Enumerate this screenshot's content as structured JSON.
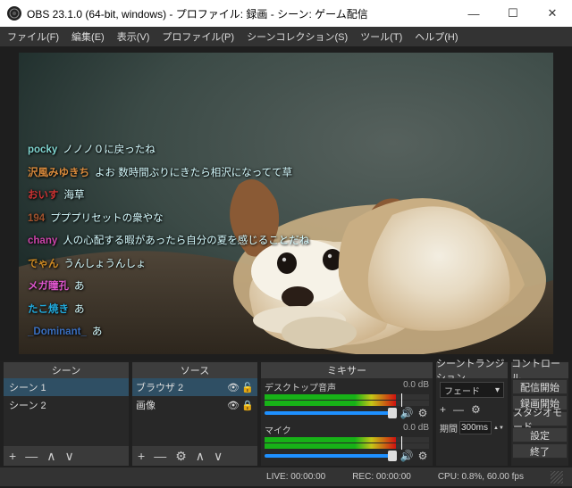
{
  "title": "OBS 23.1.0 (64-bit, windows) - プロファイル: 録画 - シーン: ゲーム配信",
  "menu": {
    "file": "ファイル(F)",
    "edit": "編集(E)",
    "view": "表示(V)",
    "profile": "プロファイル(P)",
    "scenecol": "シーンコレクション(S)",
    "tools": "ツール(T)",
    "help": "ヘルプ(H)"
  },
  "chat": [
    {
      "user": "pocky",
      "color": "#7fd4cf",
      "msg": "ノノノ０に戻ったね"
    },
    {
      "user": "沢風みゆきち",
      "color": "#d88a3c",
      "msg": "よお 数時間ぶりにきたら相沢になってて草"
    },
    {
      "user": "おいす",
      "color": "#cc3333",
      "msg": "海草"
    },
    {
      "user": "194",
      "color": "#a0522d",
      "msg": "プププリセットの衆やな"
    },
    {
      "user": "chany",
      "color": "#cc44aa",
      "msg": "人の心配する暇があったら自分の夏を感じることだね"
    },
    {
      "user": "でゃん",
      "color": "#cc8822",
      "msg": "うんしょうんしょ"
    },
    {
      "user": "メガ瞳孔",
      "color": "#dd55cc",
      "msg": "あ"
    },
    {
      "user": "たこ焼き",
      "color": "#22aadd",
      "msg": "あ"
    },
    {
      "user": "_Dominant_",
      "color": "#3a6fc0",
      "msg": "あ"
    }
  ],
  "panels": {
    "scenes_h": "シーン",
    "sources_h": "ソース",
    "mixer_h": "ミキサー",
    "trans_h": "シーントランジション",
    "ctrl_h": "コントロール",
    "scene_items": [
      "シーン 1",
      "シーン 2"
    ],
    "source_items": [
      "ブラウザ 2",
      "画像"
    ],
    "mixer": {
      "desktop": "デスクトップ音声",
      "mic": "マイク",
      "db": "0.0 dB"
    },
    "trans": {
      "sel": "フェード",
      "dur_label": "期間",
      "dur_val": "300ms"
    },
    "ctrl": {
      "stream": "配信開始",
      "rec": "録画開始",
      "studio": "スタジオモード",
      "settings": "設定",
      "exit": "終了"
    }
  },
  "status": {
    "live_label": "LIVE:",
    "live": "00:00:00",
    "rec_label": "REC:",
    "rec": "00:00:00",
    "cpu": "CPU: 0.8%, 60.00 fps"
  }
}
